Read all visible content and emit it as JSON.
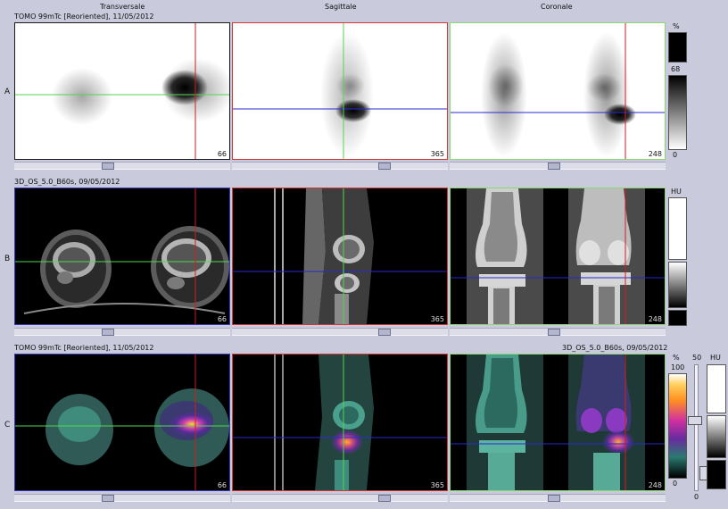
{
  "columns": {
    "transversal": "Transversale",
    "sagittal": "Sagittale",
    "coronal": "Coronale"
  },
  "rows": {
    "a": {
      "label": "A",
      "series": "TOMO 99mTc [Reoriented], 11/05/2012"
    },
    "b": {
      "label": "B",
      "series": "3D_OS_5.0_B60s, 09/05/2012"
    },
    "c": {
      "label": "C",
      "series": "TOMO 99mTc [Reoriented], 11/05/2012",
      "series_right": "3D_OS_5.0_B60s, 09/05/2012"
    }
  },
  "slices": {
    "transversal": "66",
    "sagittal": "365",
    "coronal": "248"
  },
  "colorbars": {
    "a": {
      "unit": "%",
      "top": "68",
      "bottom": "0"
    },
    "b": {
      "unit": "HU"
    },
    "c": {
      "unit": "%",
      "top": "100",
      "bottom": "0",
      "mid": "50",
      "unit2": "HU",
      "bottom2": "0"
    }
  },
  "colors": {
    "crosshair_vertical": "#d21d1d",
    "crosshair_horizontal": "#2a2ad0",
    "crosshair_green": "#52d452",
    "frame_red": "#d43535",
    "frame_blue": "#3838b8",
    "frame_green": "#8cd870"
  }
}
